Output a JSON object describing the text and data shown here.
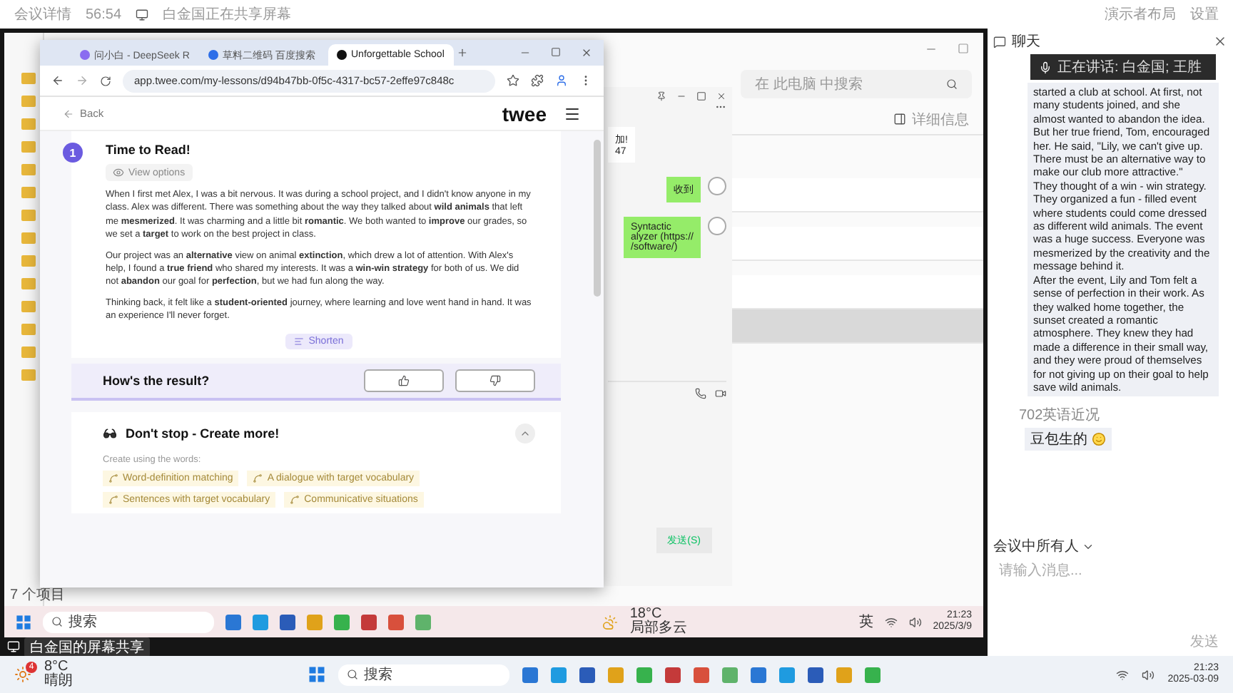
{
  "meeting_bar": {
    "left_items": [
      "会议详情",
      "56:54"
    ],
    "sharing_notice": "白金国正在共享屏幕",
    "right_items": [
      "演示者布局",
      "设置"
    ]
  },
  "browser": {
    "tabs": [
      {
        "label": "问小白 - DeepSeek R",
        "selected": false
      },
      {
        "label": "草料二维码 百度搜索",
        "selected": false
      },
      {
        "label": "Unforgettable School",
        "selected": true
      }
    ],
    "url": "app.twee.com/my-lessons/d94b47bb-0f5c-4317-bc57-2effe97c848c",
    "page": {
      "back": "Back",
      "logo": "twee",
      "step": {
        "number": "1",
        "title": "Time to Read!",
        "view_options": "View options",
        "paragraphs": [
          "When I first met Alex, I was a bit nervous. It was during a school project, and I didn't know anyone in my class. Alex was different. There was something about the way they talked about **wild animals** that left me **mesmerized**. It was charming and a little bit **romantic**. We both wanted to **improve** our grades, so we set a **target** to work on the best project in class.",
          "Our project was an **alternative** view on animal **extinction**, which drew a lot of attention. With Alex's help, I found a **true friend** who shared my interests. It was a **win-win strategy** for both of us. We did not **abandon** our goal for **perfection**, but we had fun along the way.",
          "Thinking back, it felt like a **student-oriented** journey, where learning and love went hand in hand. It was an experience I'll never forget."
        ],
        "shorten": "Shorten"
      },
      "feedback": {
        "question": "How's the result?"
      },
      "create_more": {
        "title": "Don't stop - Create more!",
        "expanded": true,
        "subtitle": "Create using the words:",
        "options": [
          "Word-definition matching",
          "A dialogue with target vocabulary",
          "Sentences with target vocabulary",
          "Communicative situations"
        ]
      }
    }
  },
  "explorer": {
    "search_placeholder": "在 此电脑 中搜索",
    "details": "详细信息",
    "status": "7 个项目",
    "rows": [
      {
        "selected": false
      },
      {
        "selected": false
      },
      {
        "selected": false
      },
      {
        "selected": true
      }
    ]
  },
  "chat_window": {
    "messages": [
      {
        "kind": "incoming",
        "text": "加!\n47"
      },
      {
        "kind": "outgoing",
        "text": "收到"
      },
      {
        "kind": "outgoing",
        "text": "Syntactic\nalyzer (https://\n/software/)"
      }
    ],
    "send": "发送(S)"
  },
  "inner_taskbar": {
    "search": "搜索",
    "weather": {
      "temp": "18°C",
      "desc": "局部多云"
    },
    "ime": "英",
    "time": "21:23",
    "date": "2025/3/9"
  },
  "share_label": "白金国的屏幕共享",
  "side_panel": {
    "title": "聊天",
    "speaking": "正在讲话: 白金国; 王胜",
    "story": [
      "started a club at school. At first, not many students joined, and she almost wanted to abandon the idea. But her true friend, Tom, encouraged her. He said, \"Lily, we can't give up. There must be an alternative way to make our club more attractive.\"",
      "They thought of a win - win strategy. They organized a fun - filled event where students could come dressed as different wild animals. The event was a huge success. Everyone was mesmerized by the creativity and the message behind it.",
      "After the event, Lily and Tom felt a sense of perfection in their work. As they walked home together, the sunset created a romantic atmosphere. They knew they had made a difference in their small way, and they were proud of themselves for not giving up on their goal to help save wild animals."
    ],
    "sender": "702英语近况",
    "reply": "豆包生的",
    "recipient": "会议中所有人",
    "input_placeholder": "请输入消息...",
    "send": "发送"
  },
  "taskbar": {
    "weather": {
      "badge": "4",
      "temp": "8°C",
      "desc": "晴朗"
    },
    "search": "搜索",
    "time": "21:23",
    "date": "2025-03-09"
  }
}
